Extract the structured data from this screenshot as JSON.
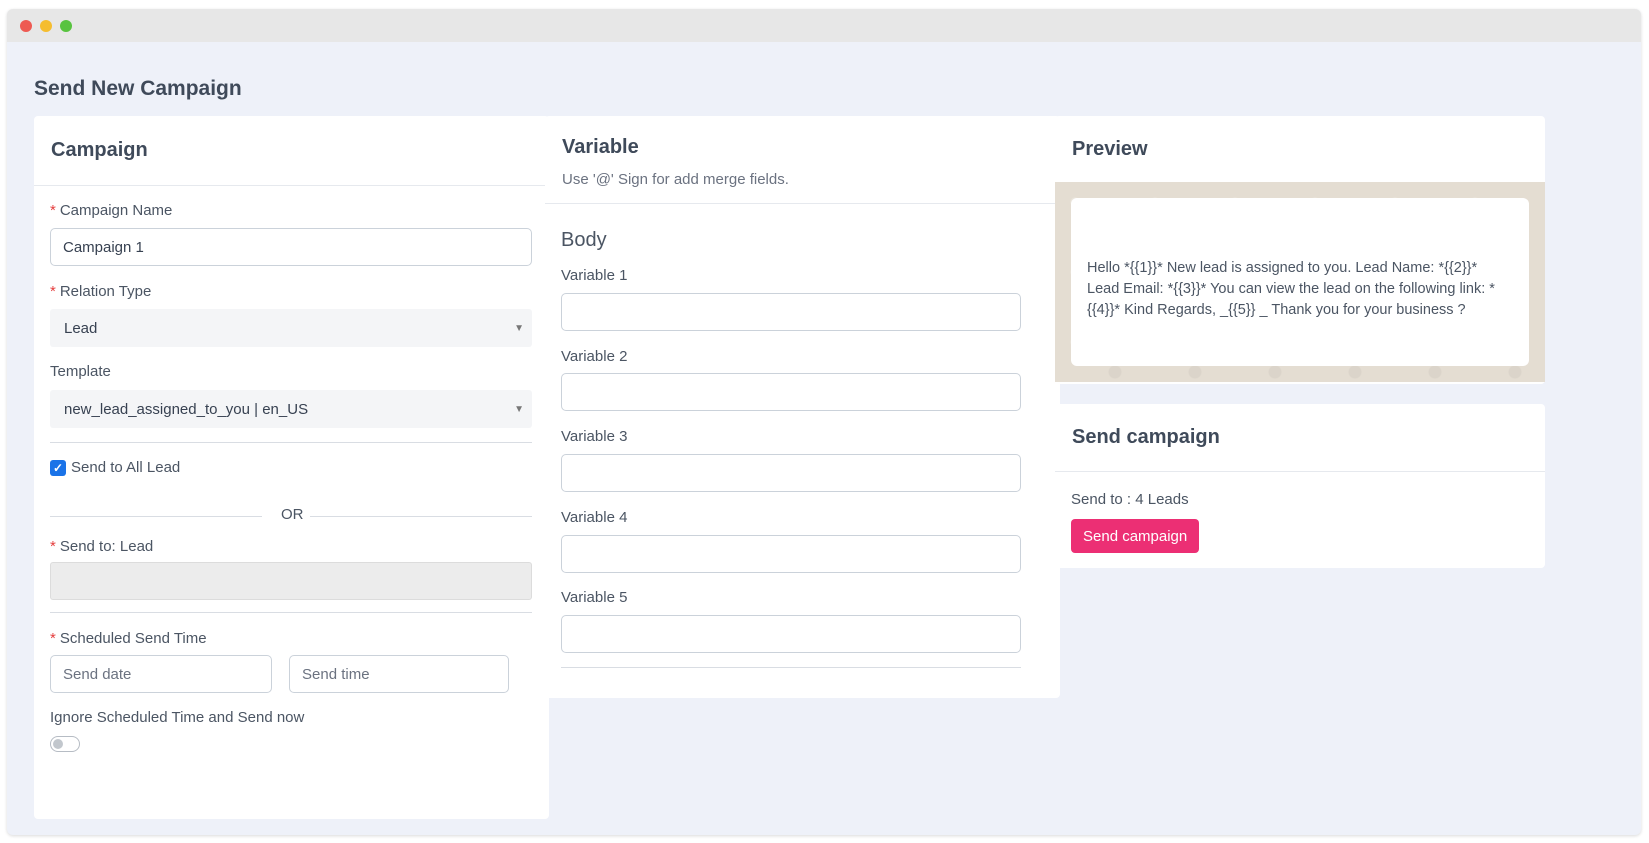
{
  "window": {
    "controls": [
      "close",
      "minimize",
      "maximize"
    ]
  },
  "page": {
    "title": "Send New Campaign"
  },
  "campaign": {
    "title": "Campaign",
    "campaign_name_label": "Campaign Name",
    "campaign_name_value": "Campaign 1",
    "relation_type_label": "Relation Type",
    "relation_type_value": "Lead",
    "template_label": "Template",
    "template_value": "new_lead_assigned_to_you | en_US",
    "send_all_label": "Send to All Lead",
    "send_all_checked": true,
    "or_text": "OR",
    "send_to_label": "Send to: Lead",
    "scheduled_label": "Scheduled Send Time",
    "send_date_placeholder": "Send date",
    "send_time_placeholder": "Send time",
    "ignore_label": "Ignore Scheduled Time and Send now",
    "ignore_toggle_on": false
  },
  "variable": {
    "title": "Variable",
    "subtitle": "Use '@' Sign for add merge fields.",
    "body_heading": "Body",
    "fields": [
      {
        "label": "Variable 1",
        "value": ""
      },
      {
        "label": "Variable 2",
        "value": ""
      },
      {
        "label": "Variable 3",
        "value": ""
      },
      {
        "label": "Variable 4",
        "value": ""
      },
      {
        "label": "Variable 5",
        "value": ""
      }
    ]
  },
  "preview": {
    "title": "Preview",
    "message": "Hello *{{1}}* New lead is assigned to you. Lead Name: *{{2}}* Lead Email: *{{3}}* You can view the lead on the following link: *{{4}}* Kind Regards, _{{5}} _ Thank you for your business ?"
  },
  "send_campaign": {
    "title": "Send campaign",
    "send_to_text": "Send to : 4 Leads",
    "button_label": "Send campaign",
    "button_color": "#ec2f74"
  }
}
